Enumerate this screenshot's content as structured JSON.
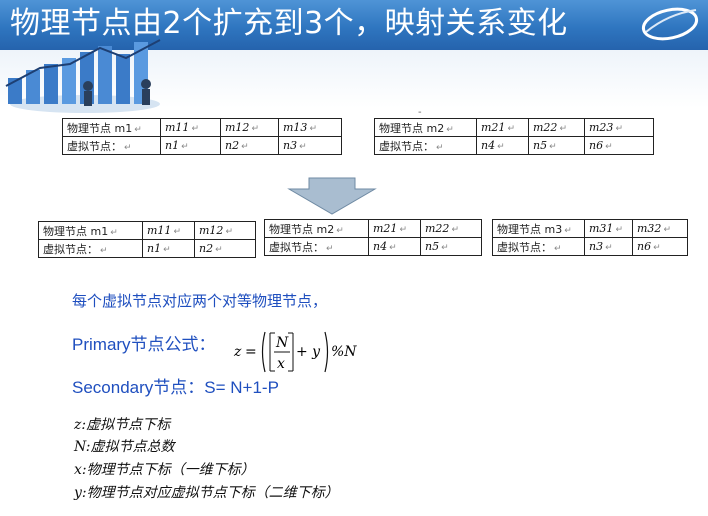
{
  "title": "物理节点由2个扩充到3个，映射关系变化",
  "before": [
    {
      "row1": [
        "物理节点 m1",
        "m11",
        "m12",
        "m13"
      ],
      "row2": [
        "虚拟节点：",
        "n1",
        "n2",
        "n3"
      ]
    },
    {
      "row1": [
        "物理节点 m2",
        "m21",
        "m22",
        "m23"
      ],
      "row2": [
        "虚拟节点：",
        "n4",
        "n5",
        "n6"
      ]
    }
  ],
  "after": [
    {
      "row1": [
        "物理节点 m1",
        "m11",
        "m12"
      ],
      "row2": [
        "虚拟节点：",
        "n1",
        "n2"
      ]
    },
    {
      "row1": [
        "物理节点 m2",
        "m21",
        "m22"
      ],
      "row2": [
        "虚拟节点：",
        "n4",
        "n5"
      ]
    },
    {
      "row1": [
        "物理节点 m3",
        "m31",
        "m32"
      ],
      "row2": [
        "虚拟节点：",
        "n3",
        "n6"
      ]
    }
  ],
  "text": {
    "line1": "每个虚拟节点对应两个对等物理节点，",
    "primary": "Primary节点公式：",
    "secondary": "Secondary节点：S= N+1-P",
    "f_z": "z",
    "f_eq": "=",
    "f_N": "N",
    "f_x": "x",
    "f_plus_y": "+ y",
    "f_mod": "%N",
    "def_z": "z:虚拟节点下标",
    "def_N": "N:虚拟节点总数",
    "def_x": "x:物理节点下标（一维下标）",
    "def_y": "y:物理节点对应虚拟节点下标（二维下标）"
  },
  "colors": {
    "title_bg": "#2f76c0",
    "accent_text": "#1f4fbf",
    "arrow": "#a9bdd0"
  }
}
